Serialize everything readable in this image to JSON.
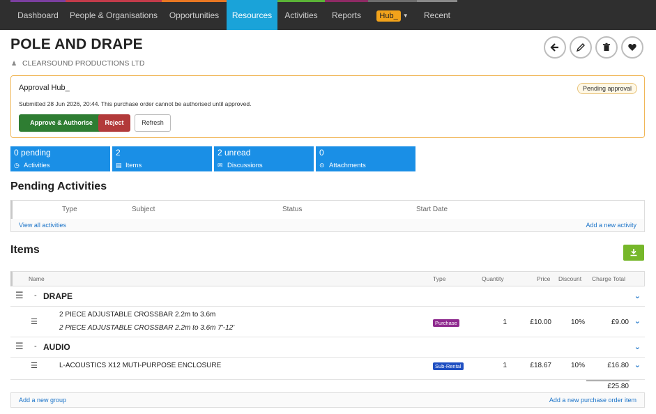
{
  "nav": {
    "items": [
      {
        "label": "Dashboard",
        "color": "#7b3fa0"
      },
      {
        "label": "People & Organisations",
        "color": "#c23b4a"
      },
      {
        "label": "Opportunities",
        "color": "#e87722"
      },
      {
        "label": "Resources",
        "color": "#1aa3d9",
        "active": true
      },
      {
        "label": "Activities",
        "color": "#5bb336"
      },
      {
        "label": "Reports",
        "color": "#8e2a64"
      },
      {
        "label": "Hub_",
        "color": "#6d6d6d"
      },
      {
        "label": "Recent",
        "color": "#8a8a8a"
      }
    ]
  },
  "header": {
    "title": "POLE AND DRAPE",
    "organisation": "CLEARSOUND PRODUCTIONS LTD",
    "actions": [
      "back-icon",
      "edit-icon",
      "delete-icon",
      "favourite-icon"
    ]
  },
  "approval": {
    "title": "Approval Hub_",
    "badge": "Pending approval",
    "message": "Submitted 28 Jun 2026, 20:44. This purchase order cannot be authorised until approved.",
    "approve_label": "Approve & Authorise",
    "reject_label": "Reject",
    "refresh_label": "Refresh"
  },
  "stats": [
    {
      "value": "0 pending",
      "label": "Activities",
      "icon": "clock-icon"
    },
    {
      "value": "2",
      "label": "Items",
      "icon": "list-icon"
    },
    {
      "value": "2 unread",
      "label": "Discussions",
      "icon": "chat-icon"
    },
    {
      "value": "0",
      "label": "Attachments",
      "icon": "paperclip-icon"
    }
  ],
  "activities": {
    "heading": "Pending Activities",
    "columns": [
      "Type",
      "Subject",
      "Status",
      "Start Date"
    ],
    "view_all": "View all activities",
    "add_new": "Add a new activity"
  },
  "items": {
    "heading": "Items",
    "columns": {
      "name": "Name",
      "type": "Type",
      "quantity": "Quantity",
      "price": "Price",
      "discount": "Discount",
      "charge_total": "Charge Total"
    },
    "groups": [
      {
        "name": "DRAPE",
        "rows": [
          {
            "name": "2 PIECE ADJUSTABLE CROSSBAR 2.2m to 3.6m",
            "description": "2 PIECE ADJUSTABLE CROSSBAR 2.2m to 3.6m 7'-12'",
            "type": "Purchase",
            "type_color": "#8e2a8e",
            "quantity": "1",
            "price": "£10.00",
            "discount": "10%",
            "total": "£9.00"
          }
        ]
      },
      {
        "name": "AUDIO",
        "rows": [
          {
            "name": "L-ACOUSTICS X12 MUTI-PURPOSE ENCLOSURE",
            "description": "",
            "type": "Sub-Rental",
            "type_color": "#1f4fc2",
            "quantity": "1",
            "price": "£18.67",
            "discount": "10%",
            "total": "£16.80"
          }
        ]
      }
    ],
    "grand_total": "£25.80",
    "add_group": "Add a new group",
    "add_item": "Add a new purchase order item"
  }
}
